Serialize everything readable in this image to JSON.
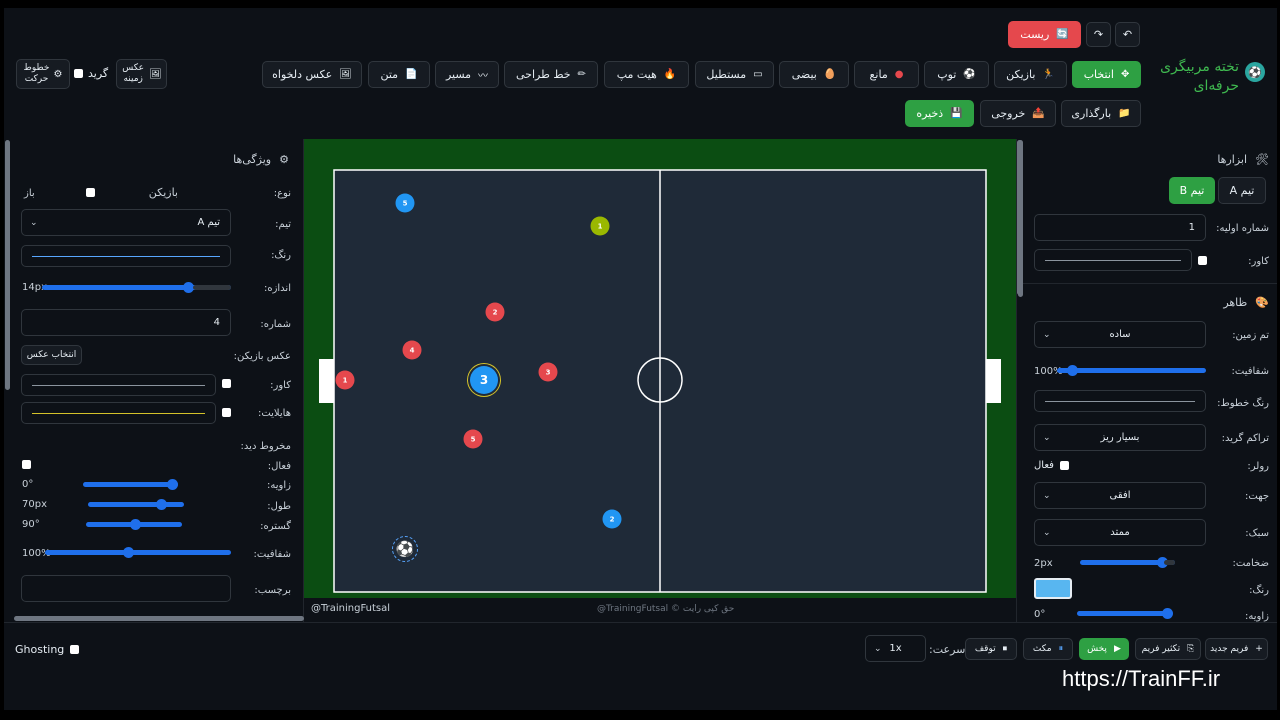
{
  "toolbar": {
    "undo_icon": "undo-arrow",
    "redo_icon": "redo-arrow",
    "reset_label": "ریست",
    "tools": [
      {
        "label": "انتخاب",
        "icon": "✥"
      },
      {
        "label": "بازیکن",
        "icon": "🏃"
      },
      {
        "label": "توپ",
        "icon": "⚽"
      },
      {
        "label": "مانع",
        "icon": "●"
      },
      {
        "label": "بیضی",
        "icon": "🥚"
      },
      {
        "label": "مستطیل",
        "icon": "▭"
      },
      {
        "label": "هیت مپ",
        "icon": "🔥"
      },
      {
        "label": "خط طراحی",
        "icon": "✏"
      },
      {
        "label": "مسیر",
        "icon": "〰"
      },
      {
        "label": "متن",
        "icon": "📄"
      },
      {
        "label": "عکس دلخواه",
        "icon": "🖼"
      }
    ],
    "background_image_label": "عکس زمینه",
    "grid_label": "گرید",
    "motion_lines_label": "خطوط حرکت",
    "load_label": "بارگذاری",
    "export_label": "خروجی",
    "save_label": "ذخیره"
  },
  "logo": {
    "title": "تخته مربیگری حرفه‌ای"
  },
  "right_panel": {
    "tools_title": "ابزارها",
    "team_a": "تیم A",
    "team_b": "تیم B",
    "start_number_label": "شماره اولیه:",
    "start_number_value": "1",
    "cover_label": "کاور:",
    "appearance_title": "ظاهر",
    "field_theme_label": "تم زمین:",
    "field_theme_value": "ساده",
    "opacity_label": "شفافیت:",
    "opacity_value": "100%",
    "line_color_label": "رنگ خطوط:",
    "grid_density_label": "تراکم گرید:",
    "grid_density_value": "بسیار ریز",
    "ruler_label": "رولر:",
    "ruler_active_label": "فعال",
    "direction_label": "جهت:",
    "direction_value": "افقی",
    "style_label": "سبک:",
    "style_value": "ممتد",
    "thickness_label": "ضخامت:",
    "thickness_value": "2px",
    "color_label": "رنگ:",
    "ruler_color": "#58b6f0",
    "angle_label": "زاویه:",
    "angle_value": "0°"
  },
  "left_panel": {
    "title": "ویژگی‌ها",
    "type_label": "نوع:",
    "type_value": "بازیکن",
    "open_label": "باز",
    "team_label": "تیم:",
    "team_value": "تیم A",
    "color_label": "رنگ:",
    "player_color": "#1f6feb",
    "size_label": "اندازه:",
    "size_value": "14px",
    "size_fraction": 0.77,
    "number_label": "شماره:",
    "number_value": "4",
    "photo_label": "عکس بازیکن:",
    "photo_button": "انتخاب عکس",
    "cover_label": "کاور:",
    "highlight_label": "هایلایت:",
    "highlight_color": "#d4c22a",
    "cone_title": "مخروط دید:",
    "active_label": "فعال:",
    "angle_label": "زاویه:",
    "angle_value": "0°",
    "length_label": "طول:",
    "length_value": "70px",
    "spread_label": "گستره:",
    "spread_value": "90°",
    "opacity_label": "شفافیت:",
    "opacity_value": "100%",
    "tag_label": "برچسب:"
  },
  "field": {
    "watermark_left": "TrainingFutsal@",
    "watermark_center": "حق کپی رایت © TrainingFutsal@",
    "colors": {
      "team_a": "#e5484d",
      "team_b": "#2196f3",
      "gk": "#9ab800",
      "pitch": "#1f2a38",
      "border": "#0b4d12"
    }
  },
  "timeline": {
    "new_frame": "فریم جدید",
    "duplicate_frame": "تکثیر فریم",
    "play": "پخش",
    "pause": "مکث",
    "stop": "توقف",
    "speed_label": "سرعت:",
    "speed_value": "1x",
    "ghosting_label": "Ghosting"
  },
  "overlay_url": "https://TrainFF.ir"
}
